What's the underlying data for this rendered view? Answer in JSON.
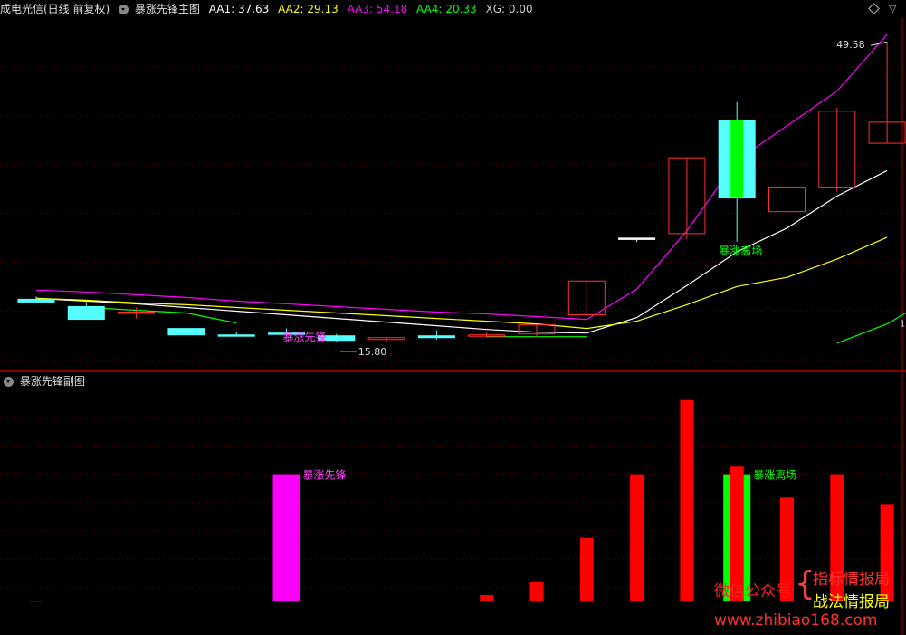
{
  "header": {
    "stock_name": "成电光信(日线 前复权)",
    "main_indicator": "暴涨先锋主图",
    "aa1": {
      "label": "AA1:",
      "value": "37.63",
      "color": "#ffffff"
    },
    "aa2": {
      "label": "AA2:",
      "value": "29.13",
      "color": "#ffff00"
    },
    "aa3": {
      "label": "AA3:",
      "value": "54.18",
      "color": "#ff00ff"
    },
    "aa4": {
      "label": "AA4:",
      "value": "20.33",
      "color": "#00ff00"
    },
    "xg": {
      "label": "XG:",
      "value": "0.00",
      "color": "#cccccc"
    },
    "sub_indicator": "暴涨先锋副图"
  },
  "annotations": {
    "high_label": "49.58",
    "low_label": "15.80",
    "signal_buy": "暴涨先锋",
    "signal_sell": "暴涨离场",
    "sub_signal_buy": "暴涨先锋",
    "sub_signal_sell": "暴涨离场",
    "axis_marker": "1"
  },
  "watermark": {
    "wechat": "微信公众号",
    "brace": "{",
    "line1": "指标情报局",
    "line2": "战法情报局",
    "url": "www.zhibiao168.com"
  },
  "chart_data": [
    {
      "type": "candlestick",
      "title": "暴涨先锋主图",
      "ylim": [
        13.5,
        52
      ],
      "bar_count": 18,
      "candles": [
        {
          "open": 21.2,
          "high": 21.5,
          "low": 20.8,
          "close": 20.9,
          "color": "cyan"
        },
        {
          "open": 20.4,
          "high": 20.9,
          "low": 19.4,
          "close": 19.0,
          "color": "cyan"
        },
        {
          "open": 19.8,
          "high": 20.3,
          "low": 19.1,
          "close": 19.8,
          "color": "red"
        },
        {
          "open": 18.0,
          "high": 18.0,
          "low": 17.9,
          "close": 17.3,
          "color": "cyan"
        },
        {
          "open": 17.3,
          "high": 17.6,
          "low": 17.1,
          "close": 17.2,
          "color": "cyan"
        },
        {
          "open": 17.5,
          "high": 18.0,
          "low": 17.2,
          "close": 17.5,
          "color": "cyan"
        },
        {
          "open": 17.2,
          "high": 17.4,
          "low": 16.5,
          "close": 16.7,
          "color": "cyan"
        },
        {
          "open": 16.8,
          "high": 17.0,
          "low": 16.5,
          "close": 17.0,
          "color": "red"
        },
        {
          "open": 17.2,
          "high": 17.8,
          "low": 16.8,
          "close": 17.0,
          "color": "cyan"
        },
        {
          "open": 17.3,
          "high": 17.6,
          "low": 17.0,
          "close": 17.3,
          "color": "red"
        },
        {
          "open": 17.4,
          "high": 18.4,
          "low": 17.0,
          "close": 18.4,
          "color": "red"
        },
        {
          "open": 19.5,
          "high": 23.2,
          "low": 19.5,
          "close": 23.2,
          "color": "red"
        },
        {
          "open": 27.9,
          "high": 27.9,
          "low": 27.5,
          "close": 27.9,
          "color": "white"
        },
        {
          "open": 28.4,
          "high": 36.7,
          "low": 27.8,
          "close": 36.7,
          "color": "red"
        },
        {
          "open": 40.8,
          "high": 42.8,
          "low": 27.5,
          "close": 32.3,
          "color": "cyan-green"
        },
        {
          "open": 30.8,
          "high": 35.3,
          "low": 30.8,
          "close": 33.5,
          "color": "red"
        },
        {
          "open": 33.5,
          "high": 42.2,
          "low": 33.0,
          "close": 41.8,
          "color": "red"
        },
        {
          "open": 38.3,
          "high": 48.2,
          "low": 38.3,
          "close": 40.6,
          "color": "red"
        }
      ],
      "series": [
        {
          "name": "AA1",
          "color": "#ffffff",
          "values": [
            21.3,
            21.0,
            20.7,
            20.3,
            19.9,
            19.5,
            19.1,
            18.7,
            18.3,
            17.9,
            17.6,
            17.5,
            19.2,
            22.7,
            26.4,
            29.0,
            32.5,
            35.3
          ]
        },
        {
          "name": "AA2",
          "color": "#ffff00",
          "values": [
            21.3,
            21.1,
            20.8,
            20.6,
            20.3,
            20.0,
            19.7,
            19.4,
            19.1,
            18.8,
            18.5,
            18.0,
            18.8,
            20.6,
            22.6,
            23.6,
            25.6,
            28.0
          ]
        },
        {
          "name": "AA3",
          "color": "#ff00ff",
          "values": [
            22.2,
            22.0,
            21.7,
            21.4,
            21.0,
            20.7,
            20.4,
            20.1,
            19.8,
            19.6,
            19.3,
            19.0,
            22.3,
            28.7,
            36.4,
            40.2,
            44.0,
            50.2
          ]
        },
        {
          "name": "AA4",
          "color": "#00ff00",
          "values": [
            null,
            20.3,
            20.0,
            19.7,
            18.6,
            null,
            null,
            null,
            null,
            17.1,
            17.1,
            17.1,
            null,
            null,
            null,
            null,
            16.4,
            18.5,
            21.7
          ]
        }
      ]
    },
    {
      "type": "bar",
      "title": "暴涨先锋副图",
      "ylim": [
        0,
        100
      ],
      "bars": [
        {
          "index": 0,
          "value": 0.3,
          "color": "#ff0000"
        },
        {
          "index": 5,
          "value": 60,
          "color": "#ff00ff"
        },
        {
          "index": 9,
          "value": 3,
          "color": "#ff0000"
        },
        {
          "index": 10,
          "value": 9,
          "color": "#ff0000"
        },
        {
          "index": 11,
          "value": 30,
          "color": "#ff0000"
        },
        {
          "index": 12,
          "value": 60,
          "color": "#ff0000"
        },
        {
          "index": 13,
          "value": 95,
          "color": "#ff0000"
        },
        {
          "index": 14,
          "value": 60,
          "color": "#00ff00"
        },
        {
          "index": 14,
          "value": 64,
          "color": "#ff0000"
        },
        {
          "index": 15,
          "value": 49,
          "color": "#ff0000"
        },
        {
          "index": 16,
          "value": 60,
          "color": "#ff0000"
        },
        {
          "index": 17,
          "value": 46,
          "color": "#ff0000"
        }
      ]
    }
  ]
}
